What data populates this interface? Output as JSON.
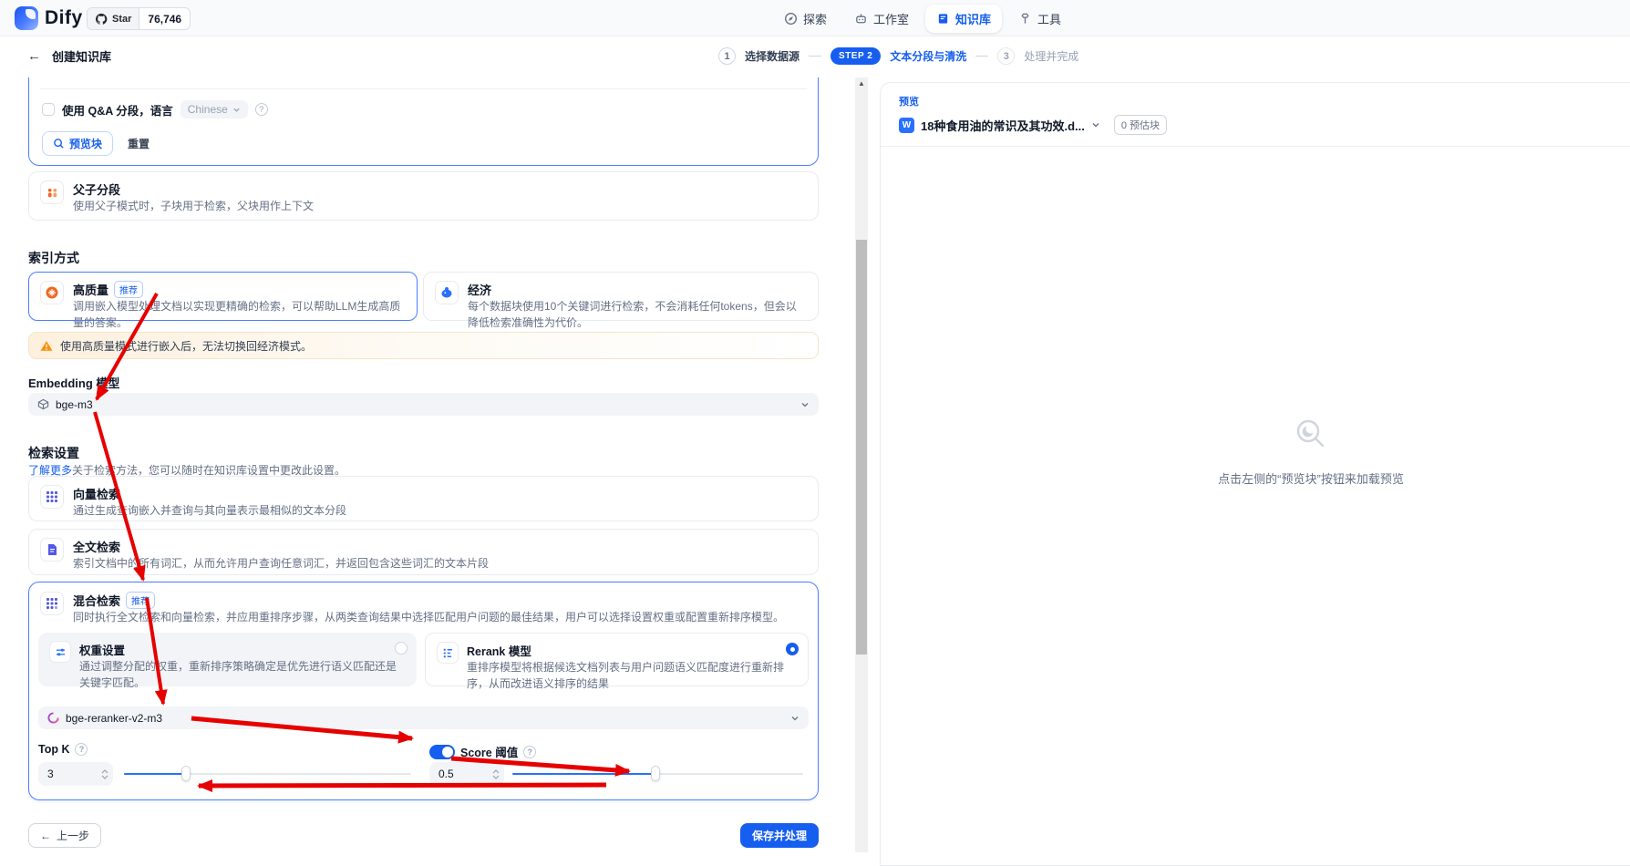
{
  "colors": {
    "primary": "#155eef",
    "selected_border": "#4e7fff",
    "annotation_red": "#e60000",
    "warning_orange": "#f79009"
  },
  "icons": {
    "back_arrow": "←",
    "help": "?",
    "scroll_up": "▲",
    "prev_arrow": "←",
    "file_letter": "W"
  },
  "topbar": {
    "logo_text": "Dify",
    "logo_suffix": "_",
    "star_label": "Star",
    "star_count": "76,746",
    "nav": [
      {
        "label": "探索"
      },
      {
        "label": "工作室"
      },
      {
        "label": "知识库"
      },
      {
        "label": "工具"
      }
    ]
  },
  "header": {
    "back_label": "创建知识库",
    "steps": {
      "s1_num": "1",
      "s1_label": "选择数据源",
      "s2_badge": "STEP 2",
      "s2_label": "文本分段与清洗",
      "s3_num": "3",
      "s3_label": "处理并完成"
    }
  },
  "qa": {
    "checkbox_label": "使用 Q&A 分段，语言",
    "language": "Chinese",
    "preview_button": "预览块",
    "reset_button": "重置"
  },
  "parent_child": {
    "title": "父子分段",
    "desc": "使用父子模式时，子块用于检索，父块用作上下文"
  },
  "index_method": {
    "section_title": "索引方式",
    "high_quality": {
      "title": "高质量",
      "badge": "推荐",
      "desc": "调用嵌入模型处理文档以实现更精确的检索，可以帮助LLM生成高质量的答案。"
    },
    "economy": {
      "title": "经济",
      "desc": "每个数据块使用10个关键词进行检索，不会消耗任何tokens，但会以降低检索准确性为代价。"
    },
    "warning": "使用高质量模式进行嵌入后，无法切换回经济模式。"
  },
  "embedding": {
    "label": "Embedding 模型",
    "model": "bge-m3"
  },
  "retrieval": {
    "section_title": "检索设置",
    "learn_more": "了解更多",
    "subtitle_rest": "关于检索方法，您可以随时在知识库设置中更改此设置。",
    "vector": {
      "title": "向量检索",
      "desc": "通过生成查询嵌入并查询与其向量表示最相似的文本分段"
    },
    "fulltext": {
      "title": "全文检索",
      "desc": "索引文档中的所有词汇，从而允许用户查询任意词汇，并返回包含这些词汇的文本片段"
    },
    "hybrid": {
      "title": "混合检索",
      "badge": "推荐",
      "desc": "同时执行全文检索和向量检索，并应用重排序步骤，从两类查询结果中选择匹配用户问题的最佳结果，用户可以选择设置权重或配置重新排序模型。",
      "weight": {
        "title": "权重设置",
        "desc": "通过调整分配的权重，重新排序策略确定是优先进行语义匹配还是关键字匹配。"
      },
      "rerank": {
        "title": "Rerank 模型",
        "desc": "重排序模型将根据候选文档列表与用户问题语义匹配度进行重新排序，从而改进语义排序的结果"
      },
      "rerank_model": "bge-reranker-v2-m3",
      "topk": {
        "label": "Top K",
        "value": "3"
      },
      "score": {
        "label": "Score 阈值",
        "value": "0.5",
        "enabled": true
      }
    }
  },
  "footer": {
    "prev_label": "上一步",
    "save_label": "保存并处理"
  },
  "preview_panel": {
    "label": "预览",
    "file_name": "18种食用油的常识及其功效.d...",
    "chunk_badge": "0 预估块",
    "empty_text": "点击左侧的“预览块”按钮来加载预览"
  }
}
